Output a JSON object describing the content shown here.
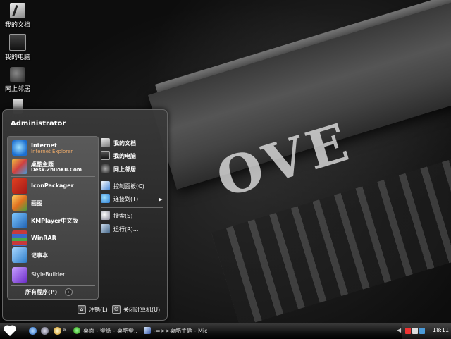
{
  "desktop": {
    "wallpaper_text": "OVE",
    "icons": [
      {
        "label": "我的文档",
        "icon": "my-documents-icon"
      },
      {
        "label": "我的电脑",
        "icon": "my-computer-icon"
      },
      {
        "label": "网上邻居",
        "icon": "network-places-icon"
      },
      {
        "label": "",
        "icon": "recycle-bin-icon"
      }
    ]
  },
  "start_menu": {
    "user": "Administrator",
    "pinned": [
      {
        "name": "Internet",
        "sub": "Internet Explorer",
        "icon": "internet-explorer-icon"
      },
      {
        "name": "桌酷主题",
        "sub": "Desk.ZhuoKu.Com",
        "icon": "zhuoku-theme-icon"
      }
    ],
    "recent": [
      {
        "name": "IconPackager",
        "icon": "iconpackager-icon"
      },
      {
        "name": "画图",
        "icon": "paint-icon"
      },
      {
        "name": "KMPlayer中文版",
        "icon": "kmplayer-icon"
      },
      {
        "name": "WinRAR",
        "icon": "winrar-icon"
      },
      {
        "name": "记事本",
        "icon": "notepad-icon"
      },
      {
        "name": "StyleBuilder",
        "icon": "stylebuilder-icon"
      }
    ],
    "all_programs": "所有程序(P)",
    "right": {
      "my_documents": "我的文档",
      "my_computer": "我的电脑",
      "network": "网上邻居",
      "control_panel": "控制面板(C)",
      "connect_to": "连接到(T)",
      "search": "搜索(S)",
      "run": "运行(R)..."
    },
    "logoff": "注销(L)",
    "shutdown": "关闭计算机(U)"
  },
  "taskbar": {
    "tasks": [
      {
        "label": "桌面 - 壁纸 - 桌酷壁...",
        "icon": "browser-icon"
      },
      {
        "label": "-=>>桌酷主题 - Mic...",
        "icon": "document-icon"
      }
    ],
    "clock": "18:11"
  }
}
